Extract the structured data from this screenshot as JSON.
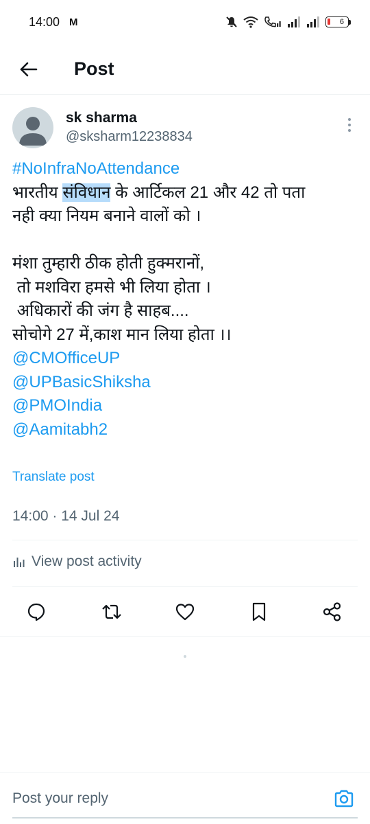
{
  "status_bar": {
    "time": "14:00",
    "gmail_glyph": "M",
    "battery": "6",
    "icons": [
      "mute-icon",
      "wifi-icon",
      "call-signal-icon",
      "signal-1-icon",
      "signal-2-icon",
      "battery-icon"
    ]
  },
  "header": {
    "title": "Post",
    "back_icon": "arrow-left-icon"
  },
  "post": {
    "author_name": "sk sharma",
    "author_handle": "@sksharm12238834",
    "hashtag": "#NoInfraNoAttendance",
    "line1_pre": "भारतीय ",
    "line1_highlight": "संविधान",
    "line1_post": " के आर्टिकल 21 और 42 तो पता",
    "line2": "नही क्या नियम बनाने वालों को ।",
    "line3": "मंशा तुम्हारी ठीक होती हुक्मरानों,",
    "line4": " तो मशविरा हमसे भी लिया होता ।",
    "line5": " अधिकारों की जंग है साहब....",
    "line6": "सोचोगे 27 में,काश मान लिया होता ।।",
    "mentions": [
      "@CMOfficeUP",
      "@UPBasicShiksha",
      "@PMOIndia",
      "@Aamitabh2"
    ],
    "translate_label": "Translate post",
    "timestamp": "14:00 · 14 Jul 24",
    "activity_label": "View post activity"
  },
  "actions": [
    "reply-icon",
    "repost-icon",
    "like-icon",
    "bookmark-icon",
    "share-icon"
  ],
  "reply": {
    "placeholder": "Post your reply",
    "camera_icon": "camera-icon"
  },
  "colors": {
    "accent": "#1d9bf0",
    "secondary_text": "#536471",
    "primary_text": "#0f1419",
    "highlight": "#b6dcfb",
    "divider": "#eff3f4"
  }
}
